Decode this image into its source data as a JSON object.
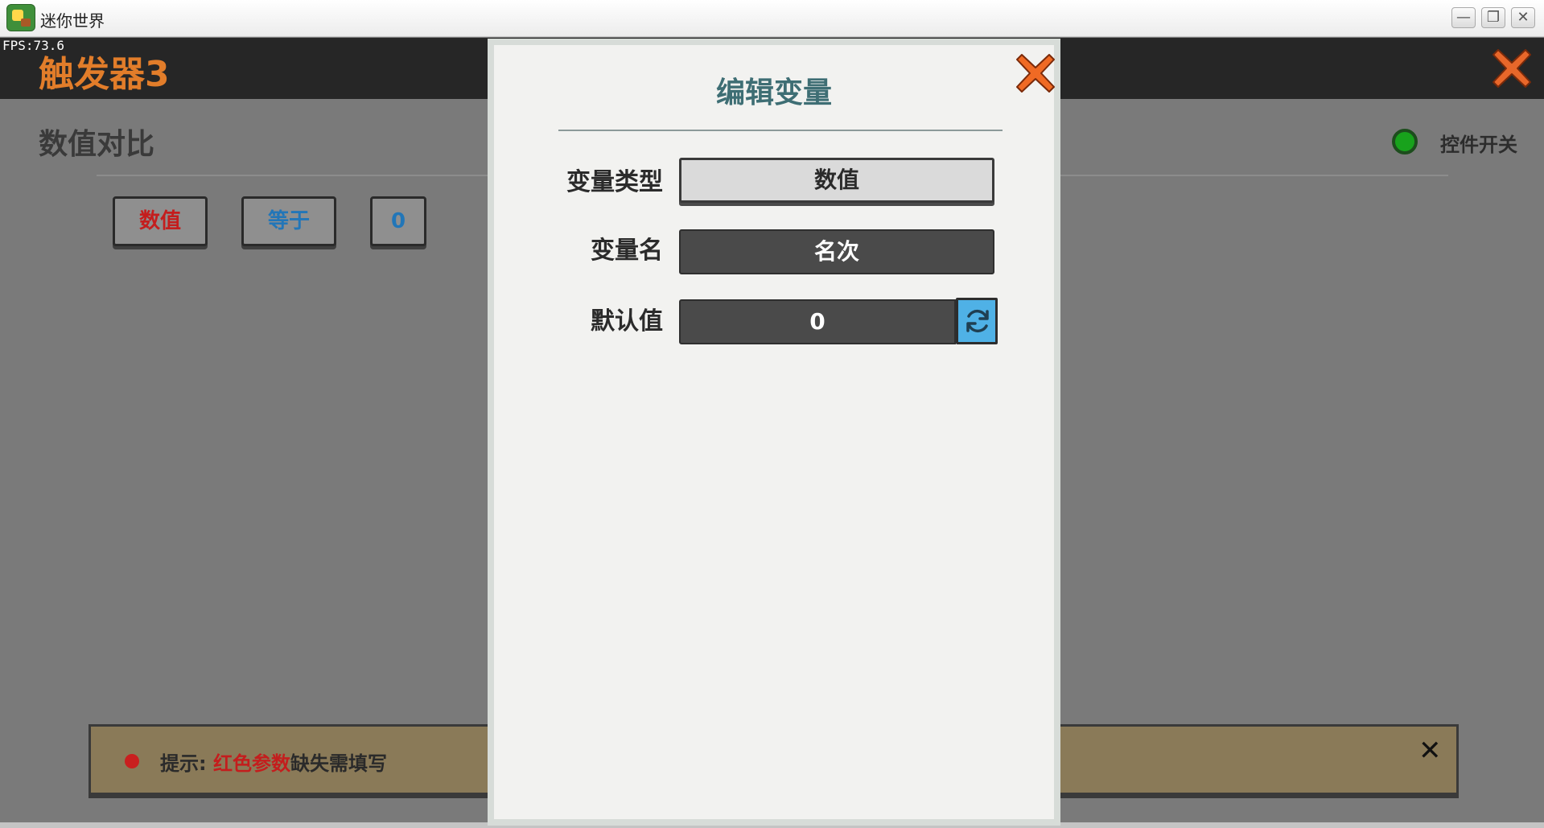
{
  "window": {
    "title": "迷你世界",
    "minimize_glyph": "—",
    "maximize_glyph": "❐",
    "close_glyph": "✕"
  },
  "hud": {
    "fps": "FPS:73.6"
  },
  "header": {
    "title": "触发器3"
  },
  "panel": {
    "section_title": "数值对比",
    "control_toggle_label": "控件开关",
    "chips": {
      "value": "数值",
      "operator": "等于",
      "operand": "0"
    }
  },
  "hint": {
    "prefix": "提示: ",
    "highlight": "红色参数",
    "suffix": "缺失需填写",
    "close_glyph": "✕"
  },
  "modal": {
    "title": "编辑变量",
    "fields": {
      "type_label": "变量类型",
      "type_value": "数值",
      "name_label": "变量名",
      "name_value": "名次",
      "default_label": "默认值",
      "default_value": "0"
    }
  },
  "colors": {
    "accent_orange": "#e27d2a",
    "title_teal": "#3e6e74",
    "error_red": "#c41d1d",
    "link_blue": "#2276b8",
    "toggle_green": "#18a21c",
    "refresh_blue": "#4fb1e6"
  },
  "icons": {
    "header_close": "close-x-icon",
    "modal_close": "close-x-icon",
    "refresh": "refresh-icon",
    "toggle": "status-dot-icon"
  }
}
